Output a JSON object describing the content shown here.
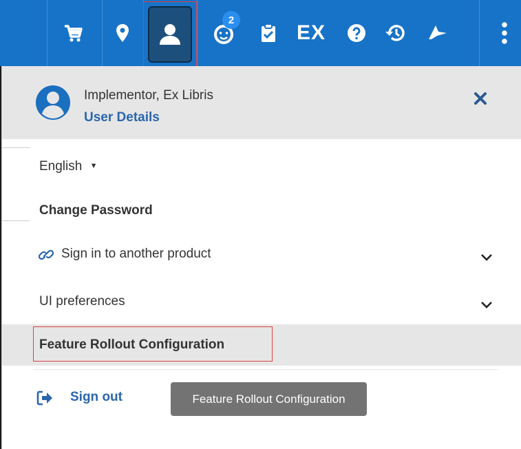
{
  "toolbar": {
    "icons": [
      "cart-icon",
      "location-icon",
      "user-icon",
      "notifications-icon",
      "tasks-icon",
      "ex-icon",
      "help-icon",
      "history-icon",
      "launch-icon",
      "more-icon"
    ],
    "notification_count": "2",
    "ex_label": "EX",
    "colors": {
      "bar": "#1773c7",
      "active": "#1c4f7c",
      "badge": "#2c8ff0"
    }
  },
  "user": {
    "name": "Implementor, Ex Libris",
    "details_link": "User Details"
  },
  "menu": {
    "language": "English",
    "language_caret": "▼",
    "change_password": "Change Password",
    "sign_in_other": "Sign in to another product",
    "ui_preferences": "UI preferences",
    "feature_rollout": "Feature Rollout Configuration",
    "sign_out": "Sign out"
  },
  "tooltip": {
    "text": "Feature Rollout Configuration"
  },
  "colors": {
    "link": "#2a66ad",
    "highlight": "#e6e6e6",
    "annotation": "#e04040"
  }
}
